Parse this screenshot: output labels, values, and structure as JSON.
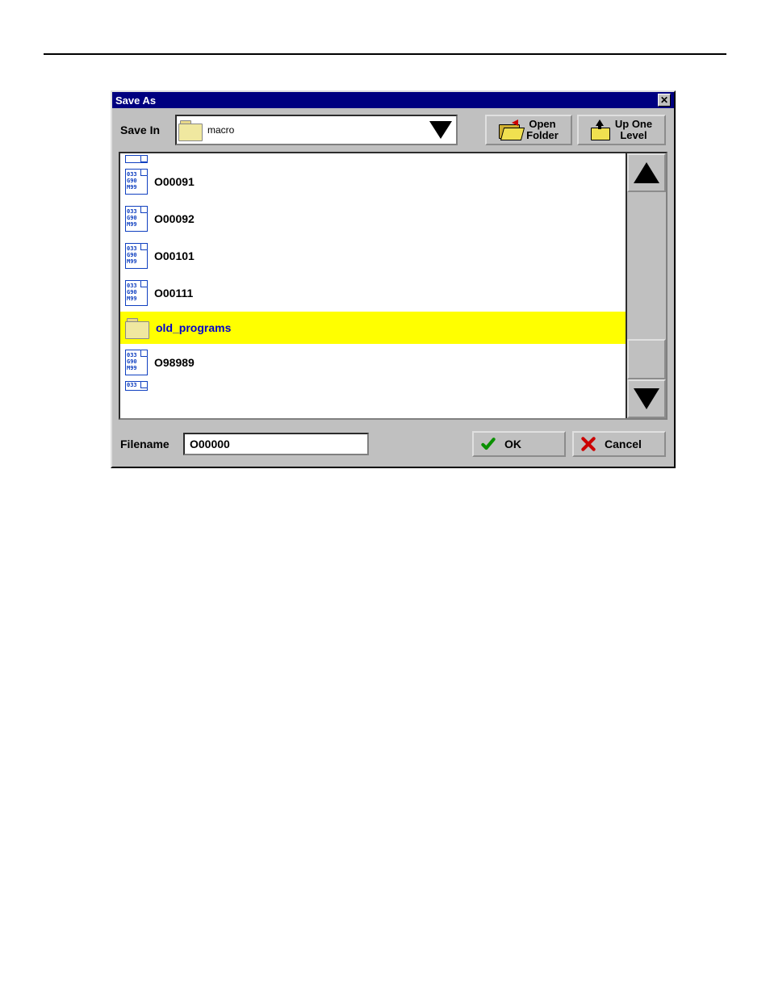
{
  "dialog": {
    "title": "Save As",
    "save_in_label": "Save In",
    "current_folder": "macro",
    "open_folder_line1": "Open",
    "open_folder_line2": "Folder",
    "up_one_line1": "Up One",
    "up_one_line2": "Level",
    "filename_label": "Filename",
    "filename_value": "O00000",
    "ok_label": "OK",
    "cancel_label": "Cancel"
  },
  "file_list": [
    {
      "type": "file",
      "name": "O00091"
    },
    {
      "type": "file",
      "name": "O00092"
    },
    {
      "type": "file",
      "name": "O00101"
    },
    {
      "type": "file",
      "name": "O00111"
    },
    {
      "type": "folder",
      "name": "old_programs",
      "selected": true
    },
    {
      "type": "file",
      "name": "O98989"
    }
  ],
  "gcode_icon_lines": [
    "033",
    "G90",
    "M99"
  ]
}
